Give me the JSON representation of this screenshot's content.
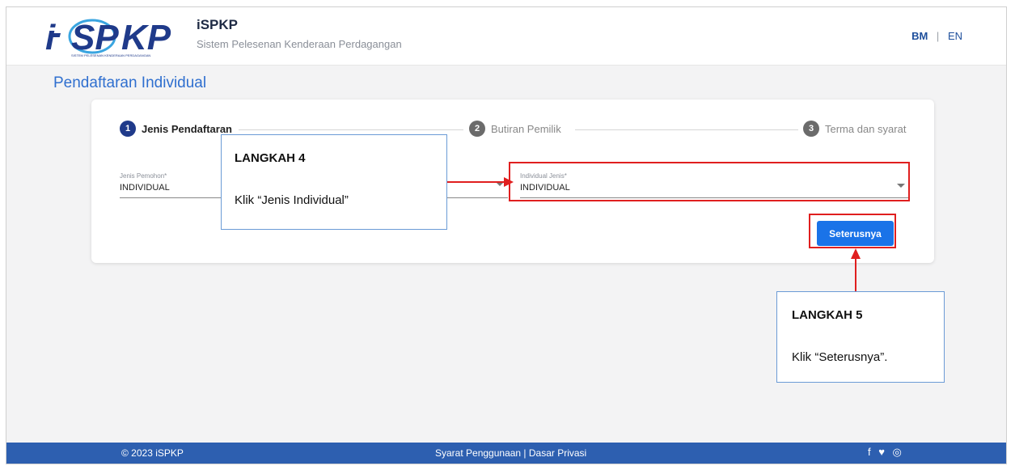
{
  "header": {
    "title": "iSPKP",
    "subtitle": "Sistem Pelesenan Kenderaan Perdagangan",
    "logo_text": "i-SPKP",
    "logo_tagline": "SISTEM PELESENAN KENDERAAN PERDAGANGAN",
    "lang_bm": "BM",
    "lang_sep": "|",
    "lang_en": "EN"
  },
  "page_title": "Pendaftaran Individual",
  "stepper": [
    {
      "num": "1",
      "label": "Jenis Pendaftaran"
    },
    {
      "num": "2",
      "label": "Butiran Pemilik"
    },
    {
      "num": "3",
      "label": "Terma dan syarat"
    }
  ],
  "form": {
    "jenis_pemohon": {
      "label": "Jenis Pemohon*",
      "value": "INDIVIDUAL"
    },
    "individual_jenis": {
      "label": "Individual Jenis*",
      "value": "INDIVIDUAL"
    },
    "next_label": "Seterusnya"
  },
  "callouts": {
    "step4_title": "LANGKAH 4",
    "step4_text": "Klik “Jenis Individual”",
    "step5_title": "LANGKAH 5",
    "step5_text": "Klik “Seterusnya”."
  },
  "footer": {
    "copyright": "© 2023 iSPKP",
    "links": "Syarat Penggunaan | Dasar Privasi",
    "social": "f ♥ ◎"
  },
  "colors": {
    "primary": "#1a73e8",
    "footer": "#2d5fb0",
    "title": "#2f6fcf",
    "annotation_red": "#e01f1f",
    "callout_border": "#6b9bd6"
  }
}
